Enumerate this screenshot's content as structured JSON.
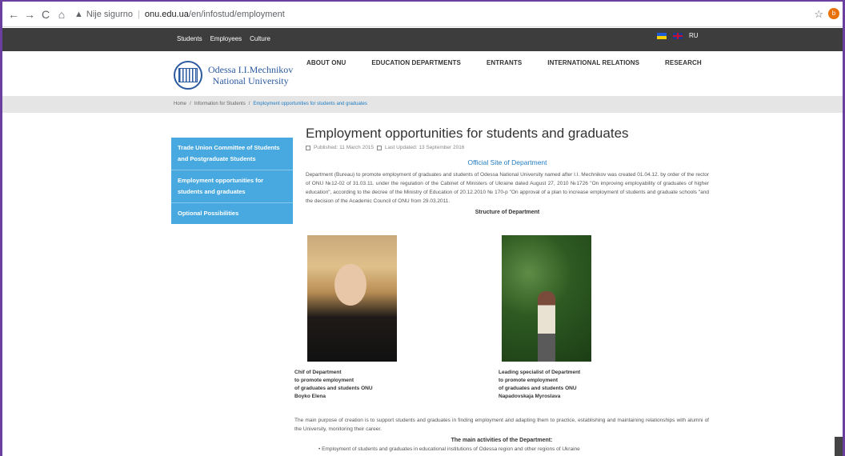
{
  "browser": {
    "back": "←",
    "forward": "→",
    "reload": "C",
    "home": "⌂",
    "insecure_label": "Nije sigurno",
    "url_domain": "onu.edu.ua",
    "url_path": "/en/infostud/employment",
    "profile_initial": "b"
  },
  "topbar": {
    "links": [
      "Students",
      "Employees",
      "Culture"
    ],
    "lang_ru": "RU"
  },
  "header": {
    "logo_line1": "Odessa I.I.Mechnikov",
    "logo_line2": "National University",
    "nav": [
      "ABOUT ONU",
      "EDUCATION DEPARTMENTS",
      "ENTRANTS",
      "INTERNATIONAL RELATIONS",
      "RESEARCH"
    ]
  },
  "breadcrumb": {
    "home": "Home",
    "sep": "/",
    "level1": "Information for Students",
    "current": "Employment opportunities for students and graduates"
  },
  "sidebar": {
    "items": [
      "Trade Union Committee of Students and Postgraduate Students",
      "Employment opportunities for students and graduates",
      "Optional Possibilities"
    ]
  },
  "article": {
    "title": "Employment opportunities for students and graduates",
    "published": "Published: 11 March 2015",
    "updated": "Last Updated: 13 September 2016",
    "official_site": "Official Site of Department",
    "intro": "Department (Bureau) to promote employment of graduates and students of Odessa National University named after I.I. Mechnikov was created 01.04.12. by order of the rector of ONU №12-02 of 31.03.11. under the regulation of the Cabinet of Ministers of Ukraine dated August 27, 2010 №1726 \"On improving employability of graduates of higher education\", according to the decree of the Ministry of Education of 20.12.2010 № 170-p \"On approval of a plan to increase employment of students and graduate schools \"and the decision of the Academic Council of ONU from 29.03.2011.",
    "structure_heading": "Structure of Department",
    "person1": [
      "Chif of Department",
      "to promote employment",
      "of graduates and students ONU",
      "Boyko Elena"
    ],
    "person2": [
      "Leading specialist of Department",
      "to promote employment",
      "of graduates and students ONU",
      "Napadovskaja Myroslava"
    ],
    "purpose": "The main purpose of creation is to support students and graduates in finding employment and adapting them to practice, establishing and maintaining relationships with alumni of the University, monitoring their career.",
    "activities_heading": "The main activities of the Department:",
    "activities": [
      "Employment of students and graduates in educational institutions of Odessa region and other regions of Ukraine"
    ]
  }
}
